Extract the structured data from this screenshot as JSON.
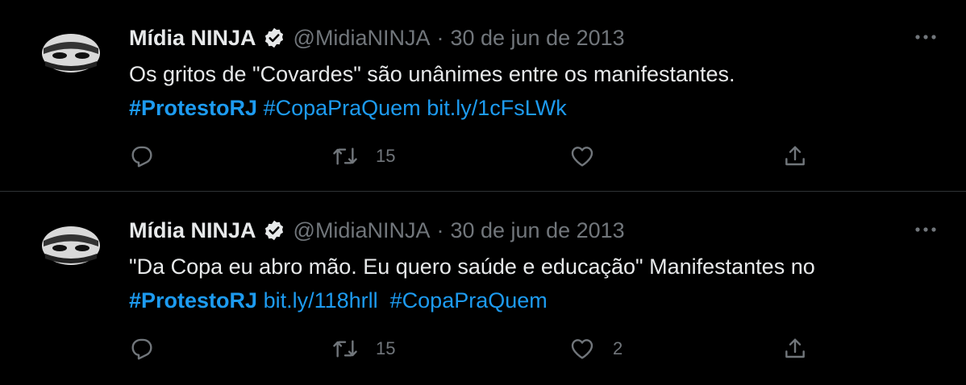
{
  "tweets": [
    {
      "display_name": "Mídia NINJA",
      "handle": "@MidiaNINJA",
      "separator": "·",
      "date": "30 de jun de 2013",
      "line1": "Os gritos de \"Covardes\" são unânimes entre os manifestantes.",
      "line2": [
        {
          "text": "#ProtestoRJ",
          "style": "hashtag-strong"
        },
        {
          "text": " ",
          "style": "plain"
        },
        {
          "text": "#CopaPraQuem",
          "style": "link"
        },
        {
          "text": " ",
          "style": "plain"
        },
        {
          "text": "bit.ly/1cFsLWk",
          "style": "link"
        }
      ],
      "reply_count": "",
      "retweet_count": "15",
      "like_count": ""
    },
    {
      "display_name": "Mídia NINJA",
      "handle": "@MidiaNINJA",
      "separator": "·",
      "date": "30 de jun de 2013",
      "line1": "\"Da Copa eu abro mão. Eu quero saúde e educação\" Manifestantes no",
      "line2": [
        {
          "text": "#ProtestoRJ",
          "style": "hashtag-strong"
        },
        {
          "text": " ",
          "style": "plain"
        },
        {
          "text": "bit.ly/118hrll",
          "style": "link"
        },
        {
          "text": "  ",
          "style": "plain"
        },
        {
          "text": "#CopaPraQuem",
          "style": "link"
        }
      ],
      "reply_count": "",
      "retweet_count": "15",
      "like_count": "2"
    }
  ],
  "icons": {
    "verified": "verified-badge-icon",
    "more": "more-options-icon",
    "reply": "reply-icon",
    "retweet": "retweet-icon",
    "like": "heart-icon",
    "share": "share-icon"
  },
  "colors": {
    "background": "#000000",
    "text": "#e7e9ea",
    "secondary": "#71767b",
    "link": "#1d9bf0",
    "divider": "#2f3336"
  }
}
